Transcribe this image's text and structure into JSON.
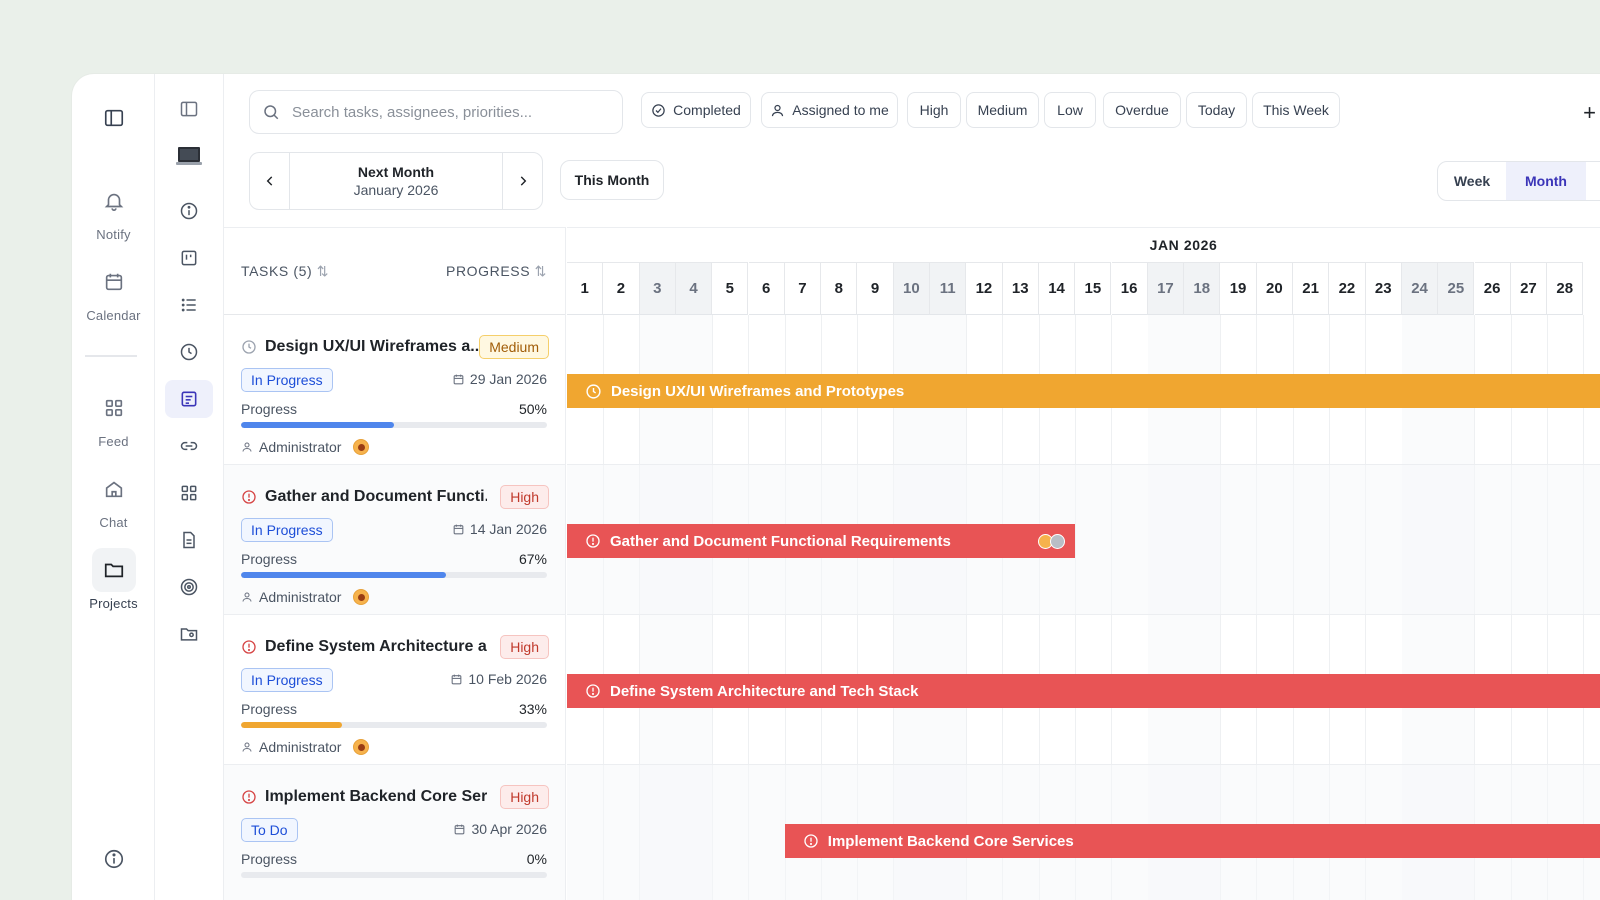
{
  "rail": {
    "items": [
      {
        "label": "",
        "icon": "sidebar-toggle-icon"
      },
      {
        "label": "Notify",
        "icon": "bell-icon"
      },
      {
        "label": "Calendar",
        "icon": "calendar-icon"
      },
      {
        "label": "Feed",
        "icon": "grid-icon"
      },
      {
        "label": "Chat",
        "icon": "home-icon"
      },
      {
        "label": "Projects",
        "icon": "folder-icon"
      }
    ]
  },
  "search": {
    "placeholder": "Search tasks, assignees, priorities..."
  },
  "filters": {
    "completed": "Completed",
    "assigned": "Assigned to me",
    "high": "High",
    "medium": "Medium",
    "low": "Low",
    "overdue": "Overdue",
    "today": "Today",
    "this_week": "This Week",
    "add": "+"
  },
  "period_nav": {
    "title": "Next Month",
    "subtitle": "January 2026",
    "this_month": "This Month"
  },
  "view_toggle": {
    "week": "Week",
    "month": "Month",
    "active": "Month"
  },
  "task_list": {
    "tasks_header": "TASKS (5)",
    "progress_header": "PROGRESS",
    "sort_glyph": "⇅"
  },
  "tasks": [
    {
      "name": "Design UX/UI Wireframes a...",
      "priority": "Medium",
      "status": "In Progress",
      "due": "29 Jan 2026",
      "progress_label": "Progress",
      "progress_text": "50%",
      "progress": 0.5,
      "bar_color": "#4f86ec",
      "assignee": "Administrator",
      "icon": "clock-icon"
    },
    {
      "name": "Gather and Document Functi...",
      "priority": "High",
      "status": "In Progress",
      "due": "14 Jan 2026",
      "progress_label": "Progress",
      "progress_text": "67%",
      "progress": 0.67,
      "bar_color": "#4f86ec",
      "assignee": "Administrator",
      "icon": "alert-circle-icon"
    },
    {
      "name": "Define System Architecture a...",
      "priority": "High",
      "status": "In Progress",
      "due": "10 Feb 2026",
      "progress_label": "Progress",
      "progress_text": "33%",
      "progress": 0.33,
      "bar_color": "#f0a630",
      "assignee": "Administrator",
      "icon": "alert-circle-icon"
    },
    {
      "name": "Implement Backend Core Ser...",
      "priority": "High",
      "status": "To Do",
      "due": "30 Apr 2026",
      "progress_label": "Progress",
      "progress_text": "0%",
      "progress": 0,
      "bar_color": "#4f86ec",
      "assignee": "",
      "icon": "alert-circle-icon"
    }
  ],
  "gantt": {
    "month_label": "JAN 2026",
    "days": [
      "1",
      "2",
      "3",
      "4",
      "5",
      "6",
      "7",
      "8",
      "9",
      "10",
      "11",
      "12",
      "13",
      "14",
      "15",
      "16",
      "17",
      "18",
      "19",
      "20",
      "21",
      "22",
      "23",
      "24",
      "25",
      "26",
      "27",
      "28"
    ],
    "weekend_days": [
      "3",
      "4",
      "10",
      "11",
      "17",
      "18",
      "24",
      "25"
    ],
    "bars": [
      {
        "label": "Design UX/UI Wireframes and Prototypes",
        "color": "#f0a630",
        "icon": "clock-icon"
      },
      {
        "label": "Gather and Document Functional Requirements",
        "color": "#e85455",
        "icon": "alert-circle-icon"
      },
      {
        "label": "Define System Architecture and Tech Stack",
        "color": "#e85455",
        "icon": "alert-circle-icon"
      },
      {
        "label": "Implement Backend Core Services",
        "color": "#e85455",
        "icon": "alert-circle-icon"
      }
    ]
  },
  "colors": {
    "accent": "#3b35b8",
    "orange": "#f0a630",
    "red": "#e85455",
    "blue": "#4f86ec"
  }
}
